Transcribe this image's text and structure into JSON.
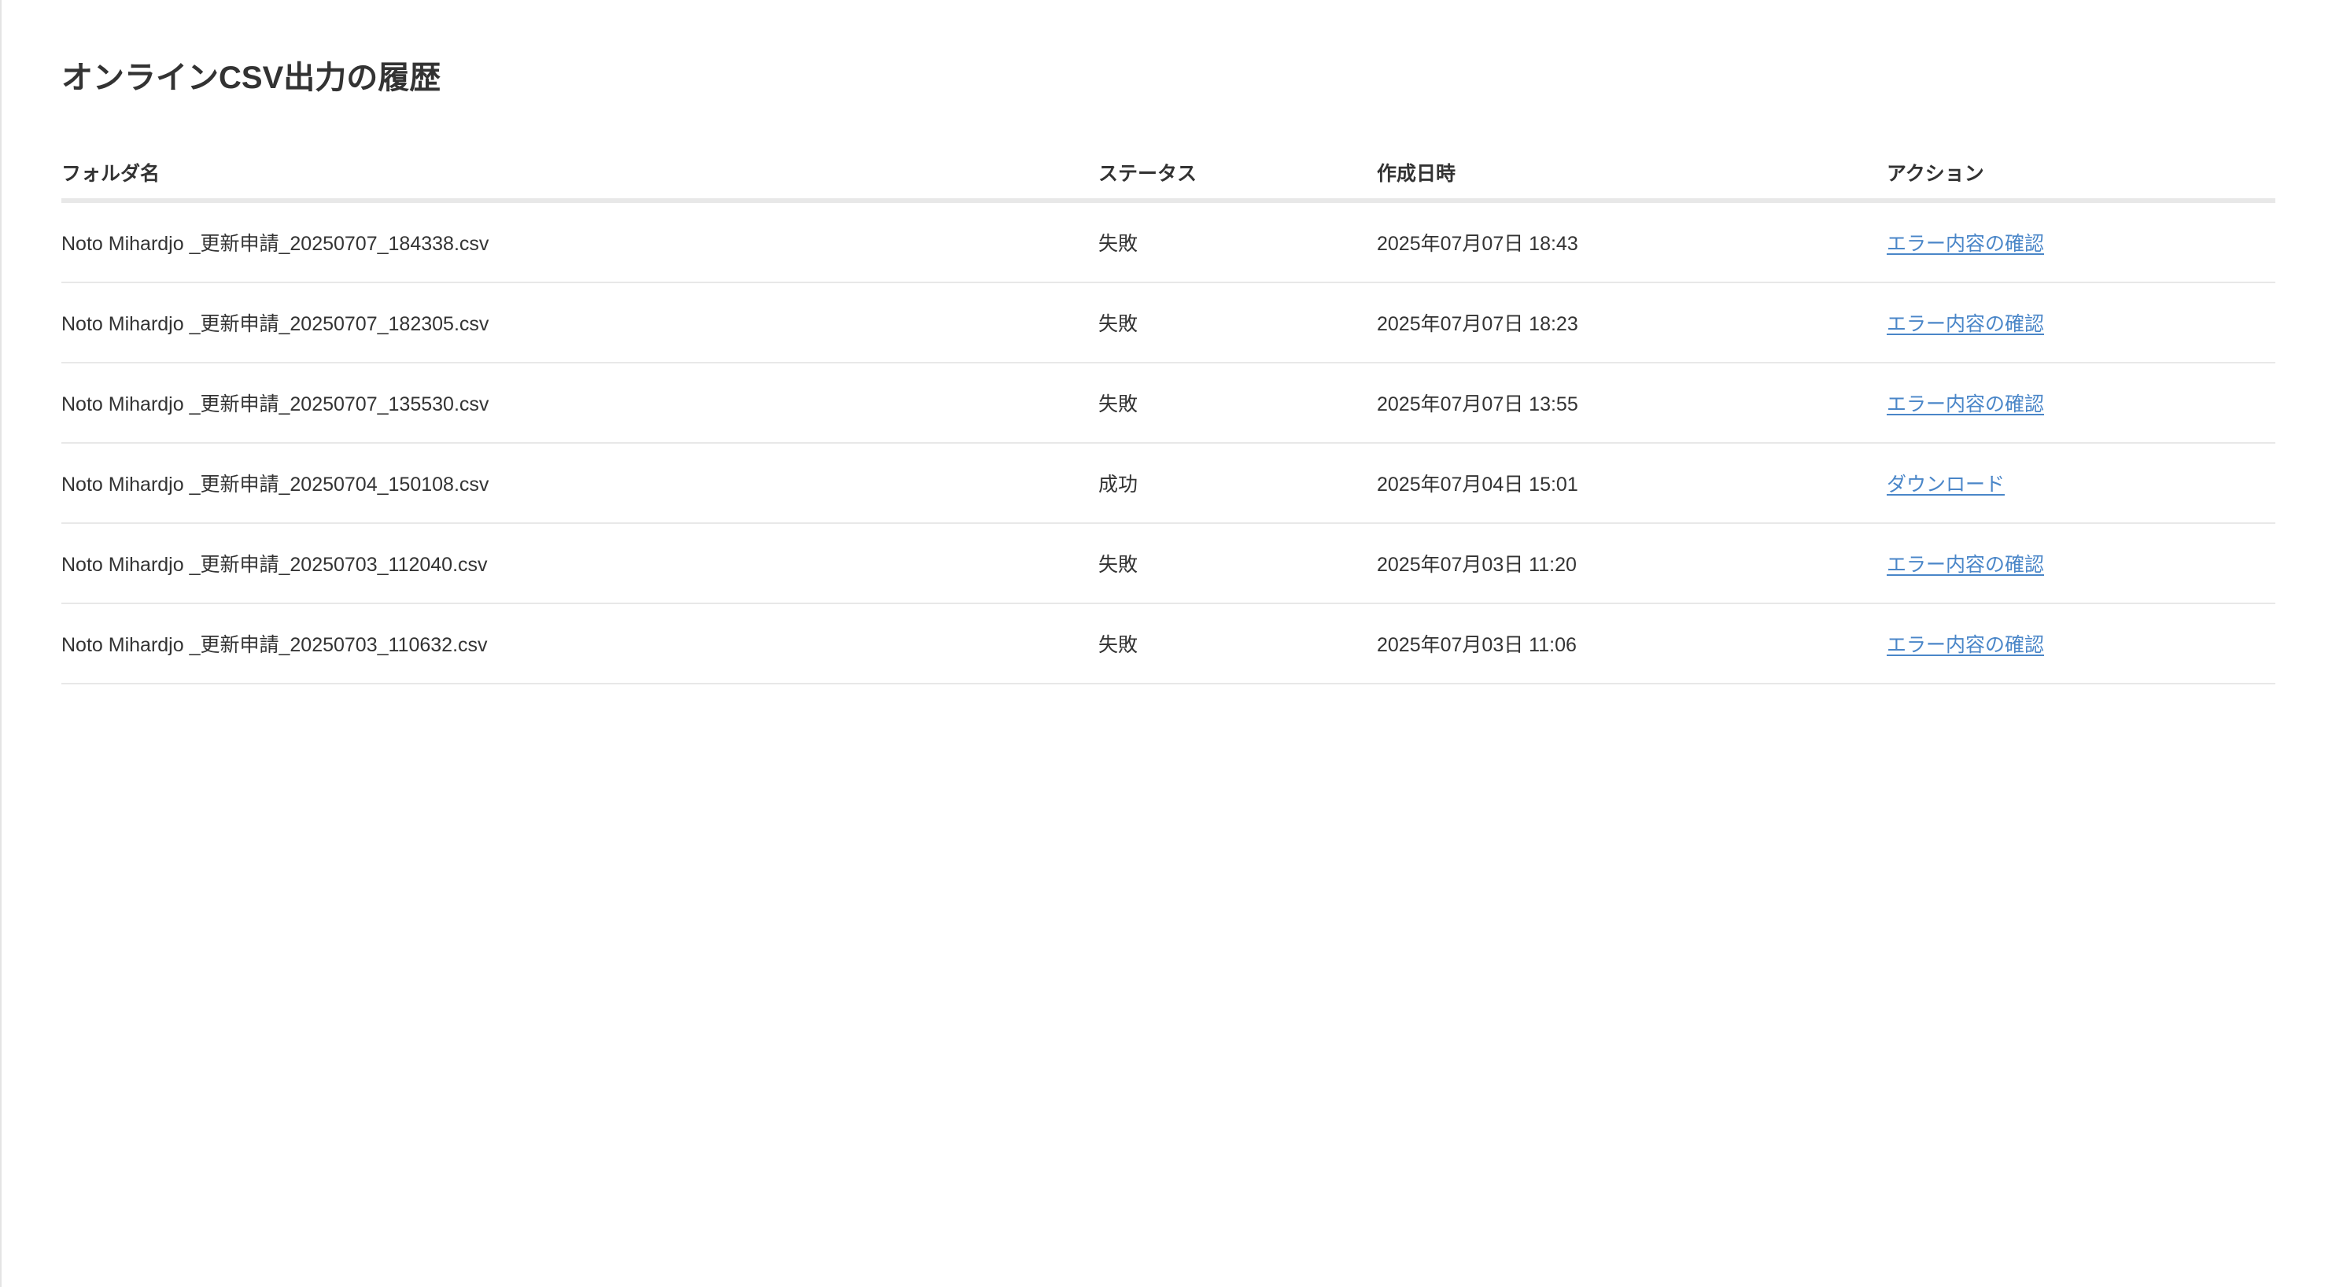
{
  "page": {
    "title": "オンラインCSV出力の履歴"
  },
  "table": {
    "headers": {
      "folder": "フォルダ名",
      "status": "ステータス",
      "date": "作成日時",
      "action": "アクション"
    },
    "rows": [
      {
        "folder": "Noto Mihardjo _更新申請_20250707_184338.csv",
        "status": "失敗",
        "date": "2025年07月07日 18:43",
        "action": "エラー内容の確認"
      },
      {
        "folder": "Noto Mihardjo _更新申請_20250707_182305.csv",
        "status": "失敗",
        "date": "2025年07月07日 18:23",
        "action": "エラー内容の確認"
      },
      {
        "folder": "Noto Mihardjo _更新申請_20250707_135530.csv",
        "status": "失敗",
        "date": "2025年07月07日 13:55",
        "action": "エラー内容の確認"
      },
      {
        "folder": "Noto Mihardjo _更新申請_20250704_150108.csv",
        "status": "成功",
        "date": "2025年07月04日 15:01",
        "action": "ダウンロード"
      },
      {
        "folder": "Noto Mihardjo _更新申請_20250703_112040.csv",
        "status": "失敗",
        "date": "2025年07月03日 11:20",
        "action": "エラー内容の確認"
      },
      {
        "folder": "Noto Mihardjo _更新申請_20250703_110632.csv",
        "status": "失敗",
        "date": "2025年07月03日 11:06",
        "action": "エラー内容の確認"
      }
    ]
  },
  "colors": {
    "text": "#333333",
    "link": "#4a86c8",
    "divider": "#e8e8e8",
    "background": "#ffffff"
  }
}
